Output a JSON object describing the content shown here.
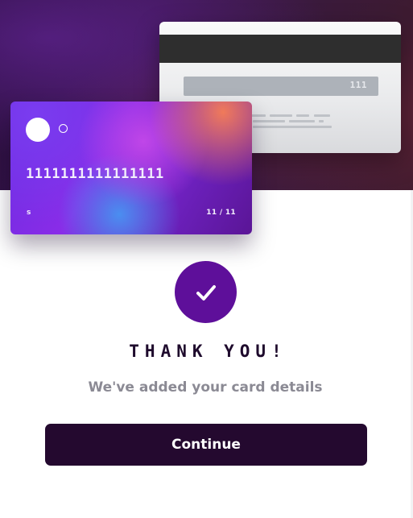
{
  "card_back": {
    "cvc": "111"
  },
  "card_front": {
    "number": "1111111111111111",
    "holder_name": "s",
    "expiry": "11 / 11"
  },
  "success": {
    "title": "THANK YOU!",
    "subtitle": "We've added your card details",
    "icon": "checkmark-icon"
  },
  "actions": {
    "continue_label": "Continue"
  },
  "colors": {
    "accent": "#5e0f9a",
    "button_bg": "#24092f",
    "title_text": "#1e0a2c",
    "subtitle_text": "#8b8a94"
  }
}
